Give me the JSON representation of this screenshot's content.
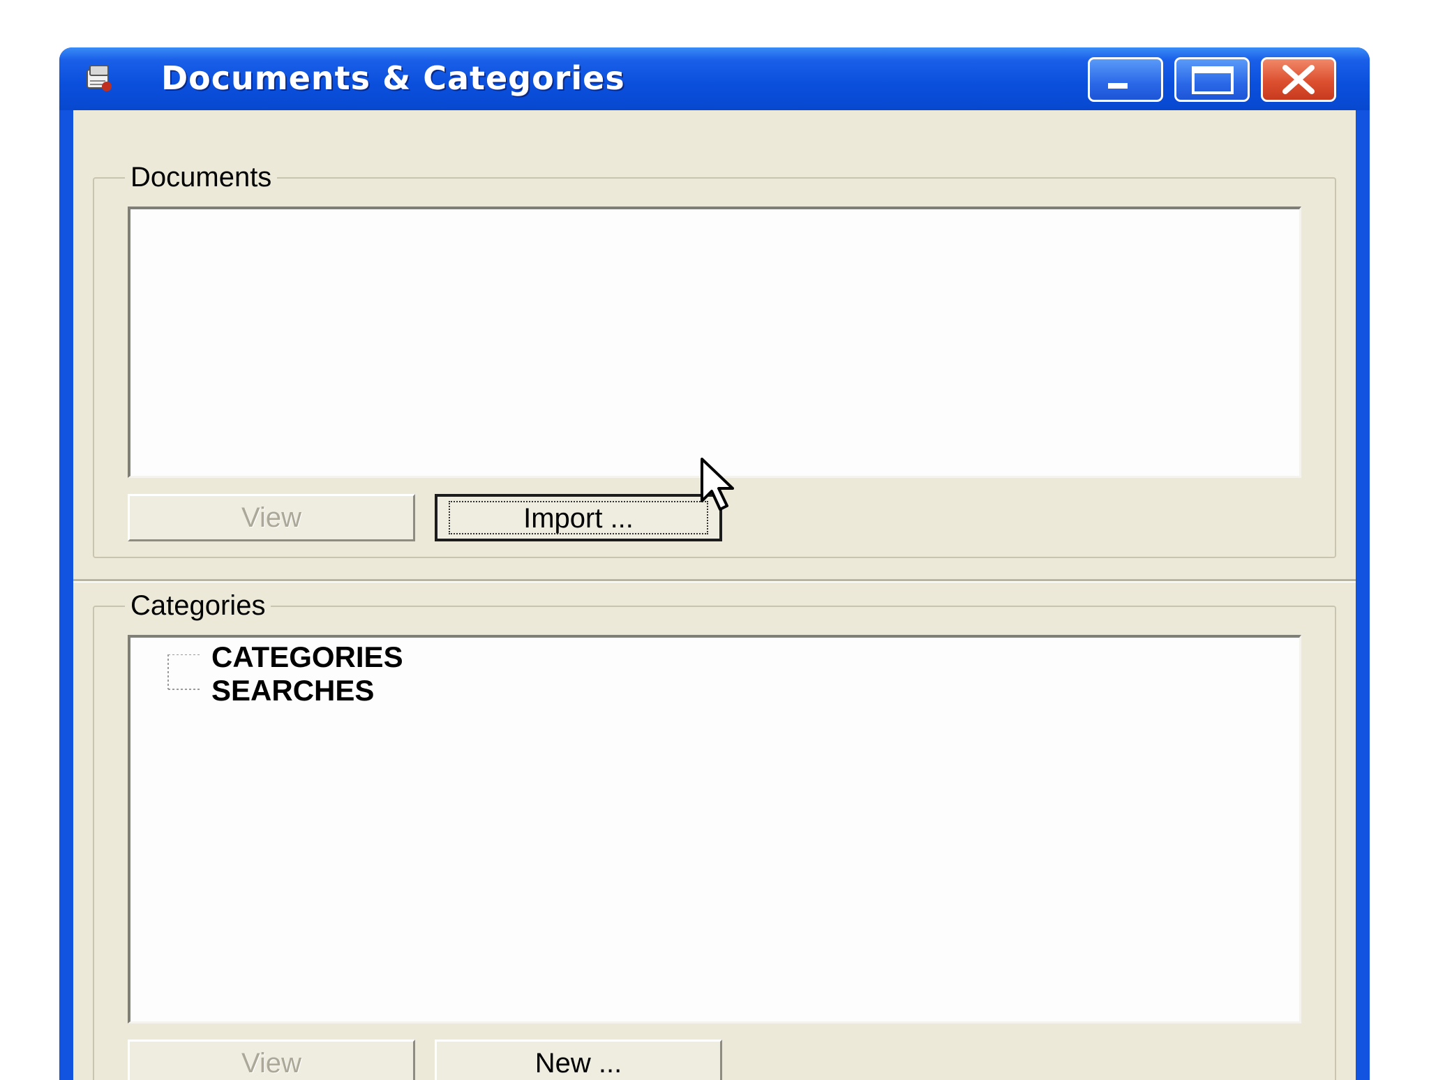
{
  "window": {
    "title": "Documents & Categories",
    "icon": "app-icon",
    "controls": [
      "minimize-icon",
      "maximize-icon",
      "close-icon"
    ]
  },
  "documents": {
    "group_label": "Documents",
    "items": [],
    "view_label": "View",
    "import_label": "Import ..."
  },
  "categories": {
    "group_label": "Categories",
    "tree": [
      {
        "label": "CATEGORIES"
      },
      {
        "label": "SEARCHES"
      }
    ],
    "view_label": "View",
    "new_label": "New ..."
  },
  "colors": {
    "titlebar": "#0a4fdc",
    "client": "#ece9d8",
    "close": "#dc5030"
  }
}
